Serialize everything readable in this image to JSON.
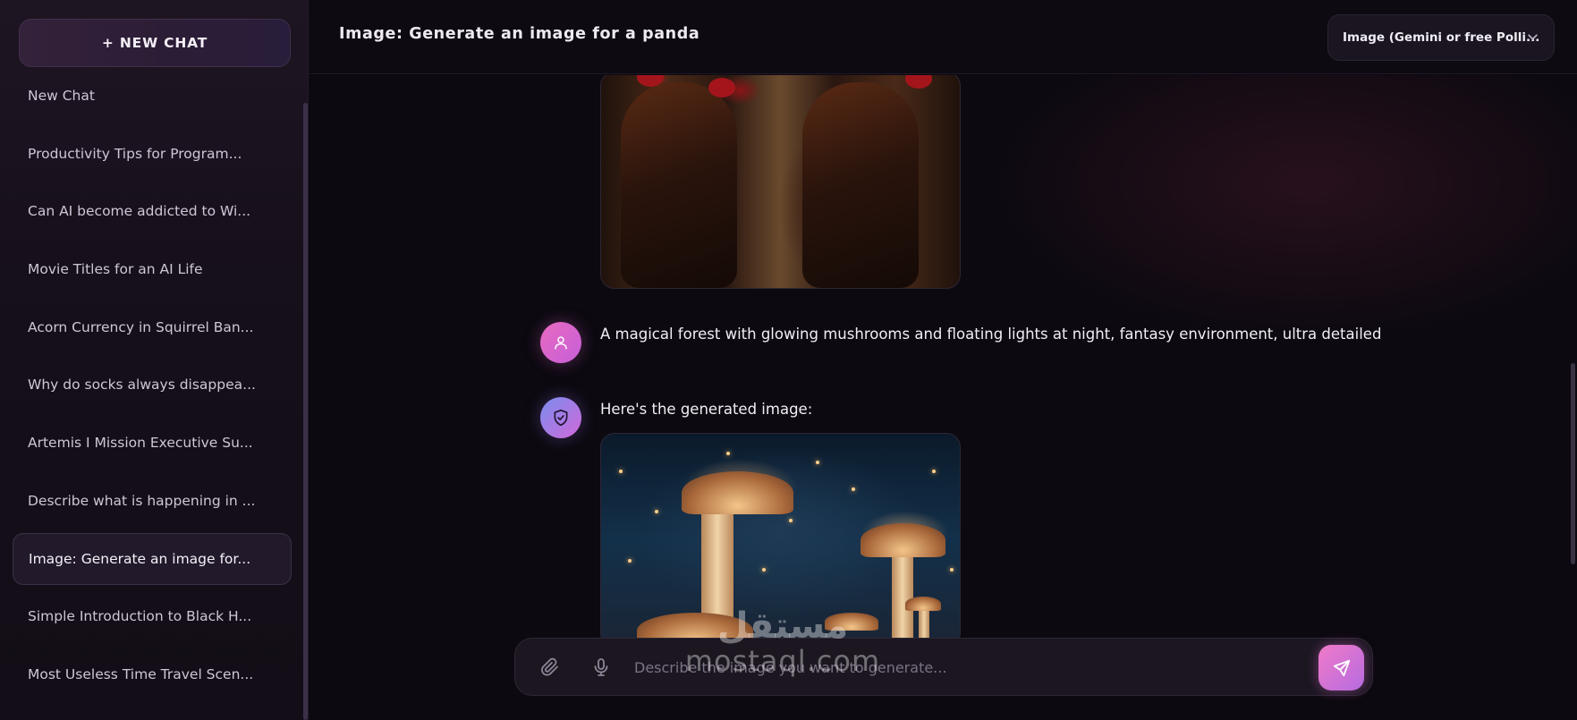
{
  "sidebar": {
    "new_chat_label": "+ NEW CHAT",
    "items": [
      {
        "label": "New Chat"
      },
      {
        "label": "Productivity Tips for Program..."
      },
      {
        "label": "Can AI become addicted to Wi..."
      },
      {
        "label": "Movie Titles for an AI Life"
      },
      {
        "label": "Acorn Currency in Squirrel Ban..."
      },
      {
        "label": "Why do socks always disappea..."
      },
      {
        "label": "Artemis I Mission Executive Su..."
      },
      {
        "label": "Describe what is happening in ..."
      },
      {
        "label": "Image: Generate an image for...",
        "active": true
      },
      {
        "label": "Simple Introduction to Black H..."
      },
      {
        "label": "Most Useless Time Travel Scen..."
      }
    ]
  },
  "header": {
    "title": "Image: Generate an image for a panda",
    "model_select_value": "Image (Gemini or free Polli...",
    "model_select_icon": "chevron-down-icon"
  },
  "chat": {
    "messages": [
      {
        "role": "assistant",
        "type": "image",
        "image_subject": "roosters"
      },
      {
        "role": "user",
        "avatar_icon": "user-icon",
        "text": "A magical forest with glowing mushrooms and floating lights at night, fantasy environment, ultra detailed"
      },
      {
        "role": "assistant",
        "avatar_icon": "shield-check-icon",
        "text": "Here's the generated image:",
        "image_subject": "magical forest with glowing mushrooms"
      }
    ]
  },
  "composer": {
    "placeholder": "Describe the image you want to generate...",
    "attach_icon": "paperclip-icon",
    "mic_icon": "microphone-icon",
    "send_icon": "send-icon"
  },
  "watermark": {
    "arabic": "مستقل",
    "latin": "mostaql.com"
  },
  "colors": {
    "accent_pink": "#f07ac8",
    "accent_purple": "#b66be0",
    "background": "#0b0810",
    "sidebar_bg": "#150f19"
  }
}
